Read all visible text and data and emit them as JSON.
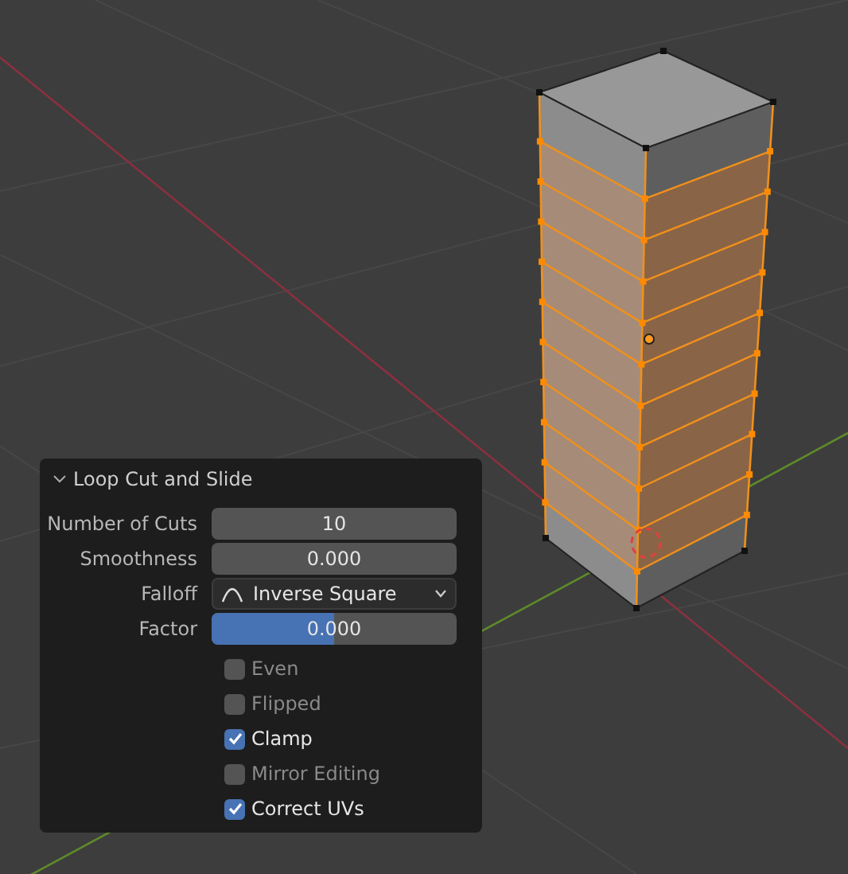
{
  "panel": {
    "title": "Loop Cut and Slide",
    "expanded": true,
    "fields": [
      {
        "kind": "number",
        "label": "Number of Cuts",
        "value": "10"
      },
      {
        "kind": "number",
        "label": "Smoothness",
        "value": "0.000"
      },
      {
        "kind": "dropdown",
        "label": "Falloff",
        "value": "Inverse Square"
      },
      {
        "kind": "slider",
        "label": "Factor",
        "value": "0.000",
        "level": 0.5
      }
    ],
    "checkboxes": [
      {
        "label": "Even",
        "checked": false
      },
      {
        "label": "Flipped",
        "checked": false
      },
      {
        "label": "Clamp",
        "checked": true
      },
      {
        "label": "Mirror Editing",
        "checked": false
      },
      {
        "label": "Correct UVs",
        "checked": true
      }
    ]
  }
}
